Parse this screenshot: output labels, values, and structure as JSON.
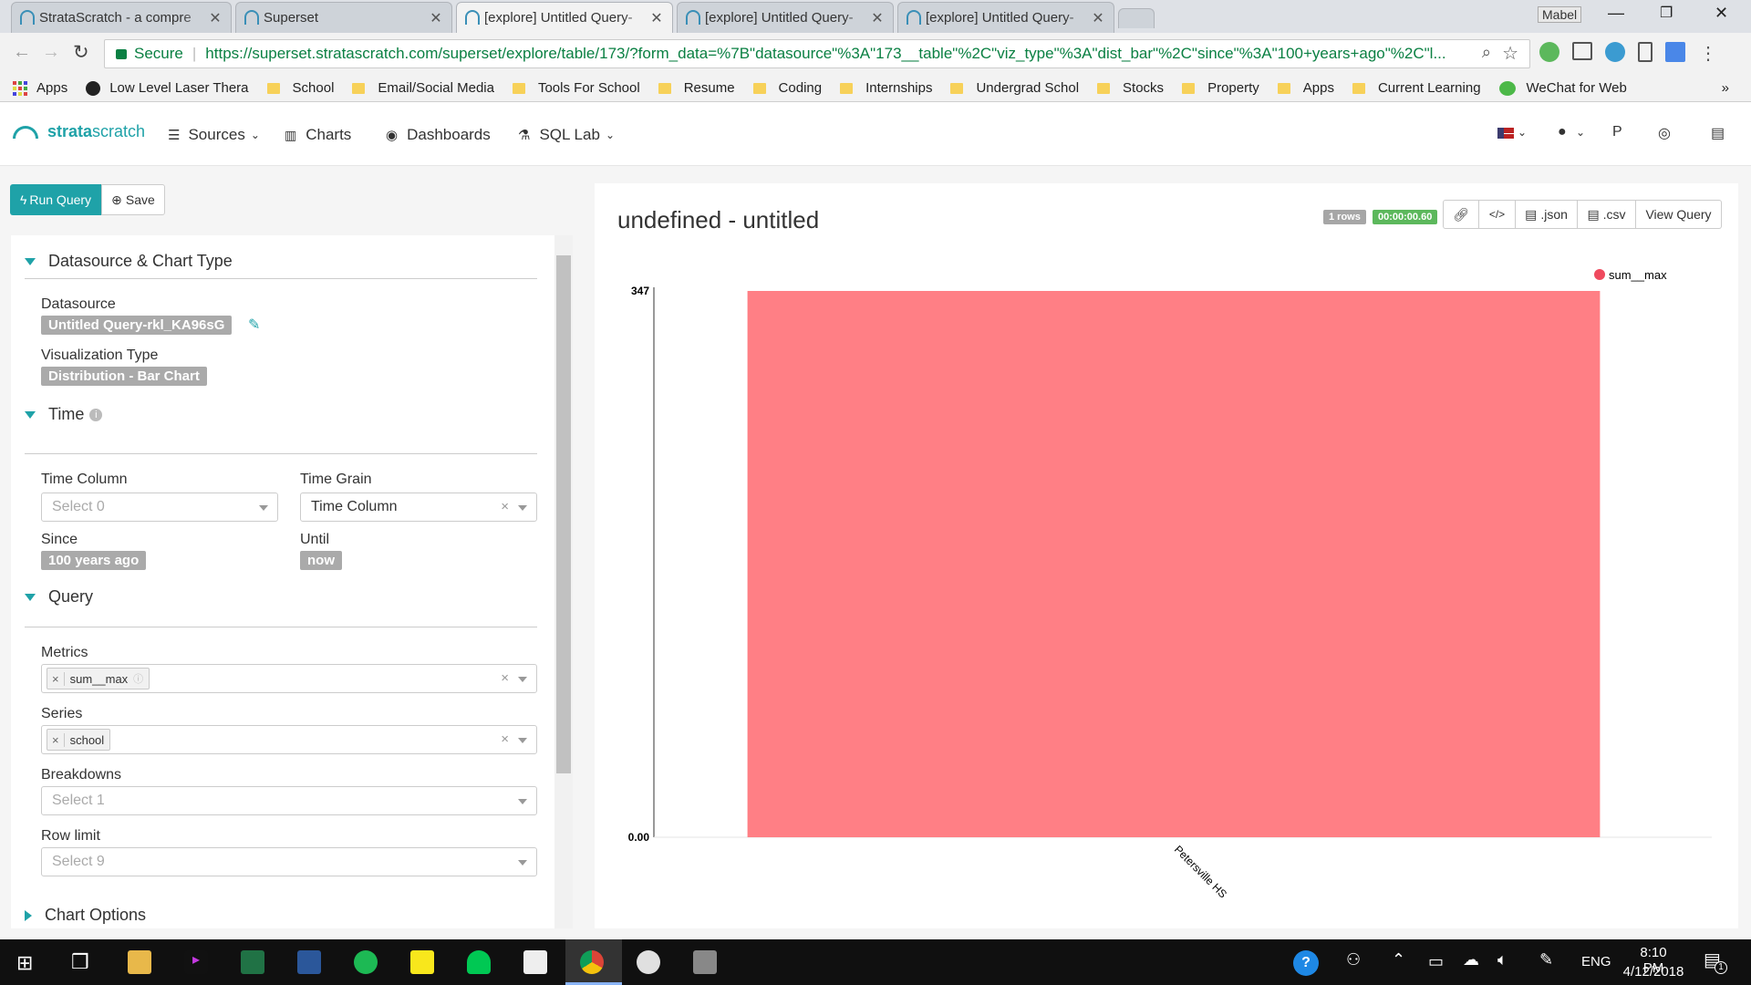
{
  "browser": {
    "tabs": [
      {
        "title": "StrataScratch - a compre",
        "active": false
      },
      {
        "title": "Superset",
        "active": false
      },
      {
        "title": "[explore] Untitled Query-",
        "active": true
      },
      {
        "title": "[explore] Untitled Query-",
        "active": false
      },
      {
        "title": "[explore] Untitled Query-",
        "active": false
      }
    ],
    "profile_name": "Mabel",
    "secure_label": "Secure",
    "url": "https://superset.stratascratch.com/superset/explore/table/173/?form_data=%7B\"datasource\"%3A\"173__table\"%2C\"viz_type\"%3A\"dist_bar\"%2C\"since\"%3A\"100+years+ago\"%2C\"l...",
    "bookmarks": [
      "Apps",
      "Low Level Laser Thera",
      "School",
      "Email/Social Media",
      "Tools For School",
      "Resume",
      "Coding",
      "Internships",
      "Undergrad Schol",
      "Stocks",
      "Property",
      "Apps",
      "Current Learning",
      "WeChat for Web"
    ]
  },
  "nav": {
    "brand_a": "strata",
    "brand_b": "scratch",
    "items": [
      "Sources",
      "Charts",
      "Dashboards",
      "SQL Lab"
    ]
  },
  "toolbar": {
    "run_query": "Run Query",
    "save": "Save"
  },
  "left": {
    "sections": {
      "datasource": "Datasource & Chart Type",
      "time": "Time",
      "query": "Query",
      "chart_options": "Chart Options"
    },
    "datasource_label": "Datasource",
    "datasource_value": "Untitled Query-rkl_KA96sG",
    "viz_label": "Visualization Type",
    "viz_value": "Distribution - Bar Chart",
    "time_column_label": "Time Column",
    "time_column_placeholder": "Select 0",
    "time_grain_label": "Time Grain",
    "time_grain_value": "Time Column",
    "since_label": "Since",
    "since_value": "100 years ago",
    "until_label": "Until",
    "until_value": "now",
    "metrics_label": "Metrics",
    "metrics_value": "sum__max",
    "series_label": "Series",
    "series_value": "school",
    "breakdowns_label": "Breakdowns",
    "breakdowns_placeholder": "Select 1",
    "rowlimit_label": "Row limit",
    "rowlimit_placeholder": "Select 9"
  },
  "right": {
    "title": "undefined - untitled",
    "rows_badge": "1 rows",
    "time_badge": "00:00:00.60",
    "json_label": ".json",
    "csv_label": ".csv",
    "view_query_label": "View Query",
    "colors": {
      "bar": "#ff7f85",
      "legend": "#ef4a5e",
      "rows_badge": "#a6a6a6",
      "time_badge": "#5cb85c"
    }
  },
  "chart_data": {
    "type": "bar",
    "categories": [
      "Petersville HS"
    ],
    "series": [
      {
        "name": "sum__max",
        "values": [
          347
        ]
      }
    ],
    "ylim": [
      0,
      347
    ],
    "y_ticks": [
      "0.00",
      "347"
    ],
    "legend_position": "top-right"
  },
  "taskbar": {
    "lang": "ENG",
    "time": "8:10 PM",
    "date": "4/12/2018",
    "notif_count": "1"
  }
}
